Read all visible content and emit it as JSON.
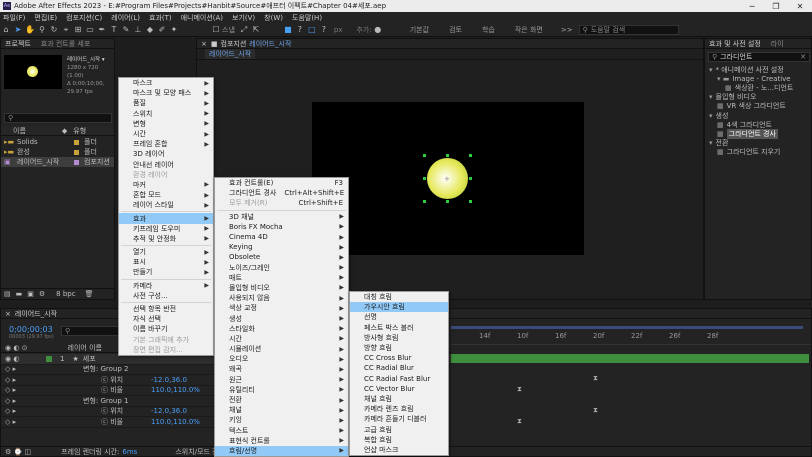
{
  "title": "Adobe After Effects 2023 - E:#Program Files#Projects#Hanbit#Source#애프터 이펙트#Chapter 04#세포.aep",
  "window_buttons": [
    "─",
    "❐",
    "✕"
  ],
  "menubar": [
    "파일(F)",
    "편집(E)",
    "컴포지션(C)",
    "레이어(L)",
    "효과(T)",
    "애니메이션(A)",
    "보기(V)",
    "창(W)",
    "도움말(H)"
  ],
  "toolbar": {
    "snap_label": "스냅",
    "px_label": "px",
    "add_label": "추가:",
    "workspaces": [
      "기본값",
      "검토",
      "학습",
      "작은 화면"
    ],
    "more": ">>",
    "search_placeholder": "도움말 검색"
  },
  "project_panel": {
    "tab": "프로젝트",
    "tab2": "효과 컨트롤 세포",
    "comp_name": "레이어드_시작 ▾",
    "comp_info1": "1280 x 720 (1.00)",
    "comp_info2": "Δ 0;00;10;00, 29.97 fps",
    "search_placeholder": "",
    "col_name": "이름",
    "col_type": "유형",
    "items": [
      {
        "name": "Solids",
        "type": "폴더"
      },
      {
        "name": "완성",
        "type": "폴더"
      },
      {
        "name": "레이어드_시작",
        "type": "컴포지션"
      }
    ],
    "bottom_bpc": "8 bpc"
  },
  "comp_panel": {
    "tab_label": "컴포지션",
    "tab_name": "레이어드_시작",
    "breadcrumb": "레이어드_시작"
  },
  "effects_panel": {
    "tab": "효과 및 사전 설정",
    "tab2": "라이",
    "search_value": "그라디언트",
    "tree": [
      {
        "label": "* 애니메이션 사전 설정",
        "indent": 0
      },
      {
        "label": "Image - Creative",
        "indent": 1
      },
      {
        "label": "색상환 - 노...디언트",
        "indent": 2
      },
      {
        "label": "몰입형 비디오",
        "indent": 0
      },
      {
        "label": "VR 색상 그라디언트",
        "indent": 1
      },
      {
        "label": "생성",
        "indent": 0
      },
      {
        "label": "4색 그라디언트",
        "indent": 1
      },
      {
        "label": "그라디언트 경사",
        "indent": 1,
        "selected": true
      },
      {
        "label": "전환",
        "indent": 0
      },
      {
        "label": "그라디언트 지우기",
        "indent": 1
      }
    ]
  },
  "context_menu": [
    {
      "label": "마스크",
      "arrow": true
    },
    {
      "label": "마스크 및 모양 패스",
      "arrow": true
    },
    {
      "label": "품질",
      "arrow": true
    },
    {
      "label": "스위치",
      "arrow": true
    },
    {
      "label": "변형",
      "arrow": true
    },
    {
      "label": "시간",
      "arrow": true
    },
    {
      "label": "프레임 혼합",
      "arrow": true
    },
    {
      "label": "3D 레이어"
    },
    {
      "label": "안내선 레이어"
    },
    {
      "label": "환경 레이어",
      "disabled": true
    },
    {
      "label": "마커",
      "arrow": true
    },
    {
      "label": "혼합 모드",
      "arrow": true
    },
    {
      "label": "레이어 스타일",
      "arrow": true
    },
    {
      "sep": true
    },
    {
      "label": "효과",
      "arrow": true,
      "highlight": true
    },
    {
      "label": "키프레임 도우미",
      "arrow": true
    },
    {
      "label": "추적 및 안정화",
      "arrow": true
    },
    {
      "sep": true
    },
    {
      "label": "열기",
      "arrow": true
    },
    {
      "label": "표시",
      "arrow": true
    },
    {
      "label": "만들기",
      "arrow": true
    },
    {
      "sep": true
    },
    {
      "label": "카메라",
      "arrow": true
    },
    {
      "label": "사전 구성..."
    },
    {
      "sep": true
    },
    {
      "label": "선택 항목 반전"
    },
    {
      "label": "자식 선택"
    },
    {
      "label": "이름 바꾸기"
    },
    {
      "label": "기본 그래픽에 추가",
      "disabled": true
    },
    {
      "label": "장면 편집 감지...",
      "disabled": true
    }
  ],
  "effects_submenu": [
    {
      "label": "효과 컨트롤(E)",
      "shortcut": "F3"
    },
    {
      "label": "그라디언트 경사",
      "shortcut": "Ctrl+Alt+Shift+E"
    },
    {
      "label": "모두 제거(R)",
      "shortcut": "Ctrl+Shift+E",
      "disabled": true
    },
    {
      "sep": true
    },
    {
      "label": "3D 채널",
      "arrow": true
    },
    {
      "label": "Boris FX Mocha",
      "arrow": true
    },
    {
      "label": "Cinema 4D",
      "arrow": true
    },
    {
      "label": "Keying",
      "arrow": true
    },
    {
      "label": "Obsolete",
      "arrow": true
    },
    {
      "label": "노이즈/그레인",
      "arrow": true
    },
    {
      "label": "매트",
      "arrow": true
    },
    {
      "label": "몰입형 비디오",
      "arrow": true
    },
    {
      "label": "사용되지 않음",
      "arrow": true
    },
    {
      "label": "색상 교정",
      "arrow": true
    },
    {
      "label": "생성",
      "arrow": true
    },
    {
      "label": "스타일화",
      "arrow": true
    },
    {
      "label": "시간",
      "arrow": true
    },
    {
      "label": "시뮬레이션",
      "arrow": true
    },
    {
      "label": "오디오",
      "arrow": true
    },
    {
      "label": "왜곡",
      "arrow": true
    },
    {
      "label": "원근",
      "arrow": true
    },
    {
      "label": "유틸리티",
      "arrow": true
    },
    {
      "label": "전환",
      "arrow": true
    },
    {
      "label": "채널",
      "arrow": true
    },
    {
      "label": "키잉",
      "arrow": true
    },
    {
      "label": "텍스트",
      "arrow": true
    },
    {
      "label": "표현식 컨트롤",
      "arrow": true
    },
    {
      "label": "흐림/선명",
      "arrow": true,
      "highlight": true
    }
  ],
  "blur_submenu": [
    {
      "label": "대칭 흐림"
    },
    {
      "label": "가우시안 흐림",
      "highlight": true
    },
    {
      "label": "선명"
    },
    {
      "label": "페스트 박스 블러"
    },
    {
      "label": "방사형 흐림"
    },
    {
      "label": "방향 흐림"
    },
    {
      "label": "CC Cross Blur"
    },
    {
      "label": "CC Radial Blur"
    },
    {
      "label": "CC Radial Fast Blur"
    },
    {
      "label": "CC Vector Blur"
    },
    {
      "label": "채널 흐림"
    },
    {
      "label": "카메라 렌즈 흐림"
    },
    {
      "label": "카메라 흔들기 디블러"
    },
    {
      "label": "고급 흐림"
    },
    {
      "label": "복합 흐림"
    },
    {
      "label": "언샵 마스크"
    }
  ],
  "timeline": {
    "tab": "레이어드_시작",
    "timecode": "0;00;00;03",
    "timecode_sub": "00003 (29.97 fps)",
    "col_layer": "레이어 이름",
    "ruler": [
      "14f",
      "10f",
      "16f",
      "20f",
      "22f",
      "26f",
      "28f"
    ],
    "rows": [
      {
        "indent": 0,
        "label": "1",
        "name": "세포",
        "value": "",
        "kind": "layer"
      },
      {
        "indent": 1,
        "label": "",
        "name": "변형: Group 2",
        "value": "",
        "kind": "group"
      },
      {
        "indent": 2,
        "label": "",
        "name": "ⓒ 위치",
        "value": "-12.0,36.0",
        "kind": "prop"
      },
      {
        "indent": 2,
        "label": "",
        "name": "ⓒ 비율",
        "value": "110.0,110.0%",
        "kind": "prop"
      },
      {
        "indent": 1,
        "label": "",
        "name": "변형: Group 1",
        "value": "",
        "kind": "group"
      },
      {
        "indent": 2,
        "label": "",
        "name": "ⓒ 위치",
        "value": "-12.0,36.0",
        "kind": "prop"
      },
      {
        "indent": 2,
        "label": "",
        "name": "ⓒ 비율",
        "value": "110.0,110.0%",
        "kind": "prop"
      }
    ],
    "footer_left": "프레임 렌더링 시간:",
    "footer_ms": "6ms",
    "footer_right": "스위치/모드 전환"
  },
  "colors": {
    "accent": "#4a9ff5",
    "highlight": "#91c9f7",
    "layer_bar": "#3d8f3d"
  }
}
